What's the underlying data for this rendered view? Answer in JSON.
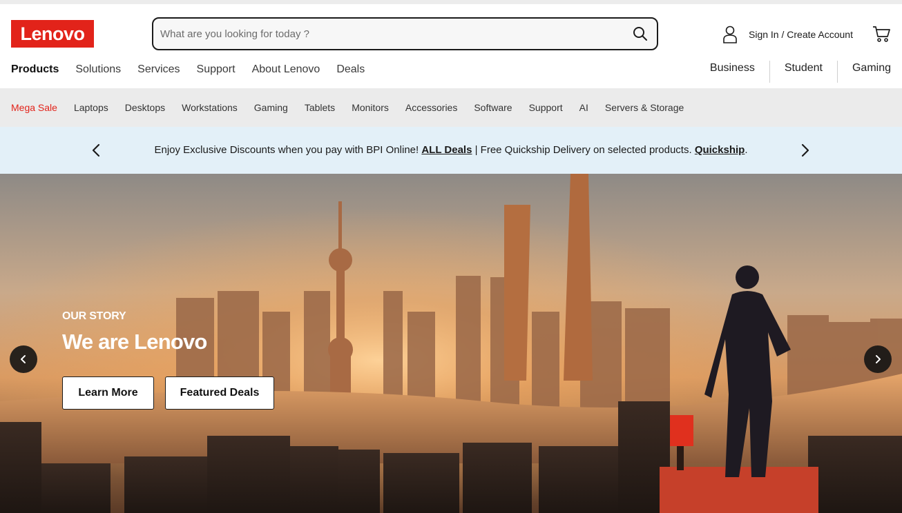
{
  "header": {
    "logo_text": "Lenovo",
    "search_placeholder": "What are you looking for today ?",
    "account_label": "Sign In / Create Account"
  },
  "main_nav": {
    "items": [
      "Products",
      "Solutions",
      "Services",
      "Support",
      "About Lenovo",
      "Deals"
    ],
    "active": "Products"
  },
  "segment_nav": {
    "items": [
      "Business",
      "Student",
      "Gaming"
    ]
  },
  "category_bar": {
    "items": [
      "Mega Sale",
      "Laptops",
      "Desktops",
      "Workstations",
      "Gaming",
      "Tablets",
      "Monitors",
      "Accessories",
      "Software",
      "Support",
      "AI",
      "Servers & Storage"
    ]
  },
  "promo": {
    "text_1": "Enjoy Exclusive Discounts when you pay with BPI Online! ",
    "link_1": "ALL Deals",
    "text_2": " | Free Quickship Delivery on selected  products. ",
    "link_2": "Quickship",
    "text_3": "."
  },
  "hero": {
    "kicker": "OUR STORY",
    "headline": "We are Lenovo",
    "buttons": [
      "Learn More",
      "Featured Deals"
    ]
  },
  "colors": {
    "brand_red": "#e2231a",
    "promo_bg": "#e3f0f8",
    "category_bg": "#ebebeb"
  },
  "icons": [
    "search-icon",
    "user-icon",
    "cart-icon",
    "chevron-left-icon",
    "chevron-right-icon"
  ]
}
